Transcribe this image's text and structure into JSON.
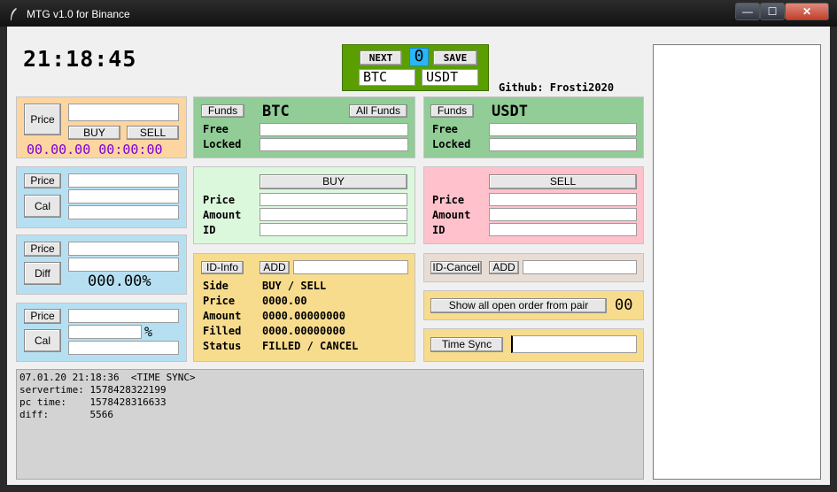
{
  "window": {
    "title": "MTG v1.0 for Binance",
    "min": "—",
    "max": "☐",
    "close": "✕"
  },
  "clock": "21:18:45",
  "top": {
    "next_label": "NEXT",
    "counter": "0",
    "save_label": "SAVE",
    "base": "BTC",
    "quote": "USDT"
  },
  "github": "Github: Frosti2020",
  "calc1": {
    "price_label": "Price",
    "buy_label": "BUY",
    "sell_label": "SELL",
    "timestamp": "00.00.00 00:00:00"
  },
  "calc2": {
    "price_label": "Price",
    "cal_label": "Cal"
  },
  "calc3": {
    "price_label": "Price",
    "diff_label": "Diff",
    "percent": "000.00%"
  },
  "calc4": {
    "price_label": "Price",
    "cal_label": "Cal",
    "percent_sign": "%"
  },
  "funds_base": {
    "funds_label": "Funds",
    "coin": "BTC",
    "all_funds_label": "All Funds",
    "free_label": "Free",
    "locked_label": "Locked"
  },
  "funds_quote": {
    "funds_label": "Funds",
    "coin": "USDT",
    "free_label": "Free",
    "locked_label": "Locked"
  },
  "buy_panel": {
    "button": "BUY",
    "price_label": "Price",
    "amount_label": "Amount",
    "id_label": "ID"
  },
  "sell_panel": {
    "button": "SELL",
    "price_label": "Price",
    "amount_label": "Amount",
    "id_label": "ID"
  },
  "info": {
    "id_info_label": "ID-Info",
    "add_label": "ADD",
    "rows": [
      {
        "label": "Side",
        "value": "BUY / SELL"
      },
      {
        "label": "Price",
        "value": "0000.00"
      },
      {
        "label": "Amount",
        "value": "0000.00000000"
      },
      {
        "label": "Filled",
        "value": "0000.00000000"
      },
      {
        "label": "Status",
        "value": "FILLED / CANCEL"
      }
    ]
  },
  "cancel": {
    "id_cancel_label": "ID-Cancel",
    "add_label": "ADD"
  },
  "orders": {
    "button": "Show all open order from pair",
    "count": "00"
  },
  "timesync": {
    "button": "Time Sync"
  },
  "log": {
    "lines": [
      "07.01.20 21:18:36  <TIME SYNC>",
      "servertime: 1578428322199",
      "pc time:    1578428316633",
      "diff:       5566"
    ]
  },
  "colors": {
    "orange": "#fdd5a0",
    "blue": "#b6e0f2",
    "green": "#92cc97",
    "lightgreen": "#dcf8dc",
    "pink": "#ffc2cc",
    "yellow": "#f7dc8e",
    "counter": "#29b6f6",
    "purple": "#7a00d8"
  },
  "icons": {
    "app": "feather-icon"
  }
}
